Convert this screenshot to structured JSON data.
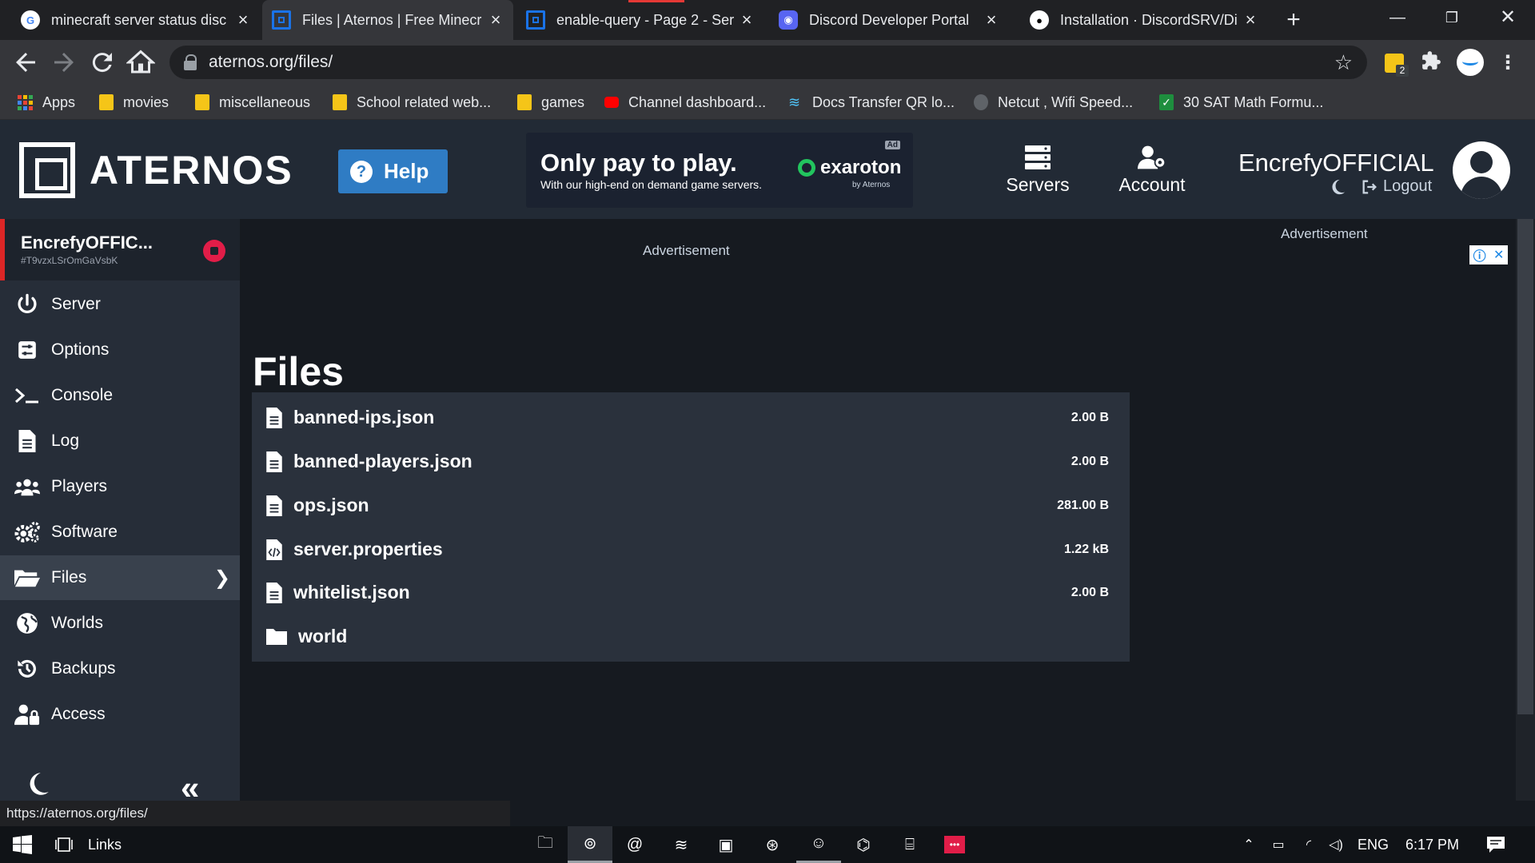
{
  "browser": {
    "tabs": [
      {
        "title": "minecraft server status disc",
        "favicon": "google-icon",
        "active": false
      },
      {
        "title": "Files | Aternos | Free Minecr",
        "favicon": "aternos-icon",
        "active": true
      },
      {
        "title": "enable-query - Page 2 - Ser",
        "favicon": "aternos-icon",
        "active": false
      },
      {
        "title": "Discord Developer Portal",
        "favicon": "discord-icon",
        "active": false
      },
      {
        "title": "Installation · DiscordSRV/Di",
        "favicon": "github-icon",
        "active": false
      }
    ],
    "url": "aternos.org/files/",
    "extension_badge": "2",
    "bookmarks": [
      {
        "label": "Apps",
        "icon": "apps-grid-icon"
      },
      {
        "label": "movies",
        "icon": "folder-icon"
      },
      {
        "label": "miscellaneous",
        "icon": "folder-icon"
      },
      {
        "label": "School related web...",
        "icon": "folder-icon"
      },
      {
        "label": "games",
        "icon": "folder-icon"
      },
      {
        "label": "Channel dashboard...",
        "icon": "youtube-icon"
      },
      {
        "label": "Docs Transfer QR lo...",
        "icon": "wifi-icon"
      },
      {
        "label": "Netcut , Wifi Speed...",
        "icon": "netcut-icon"
      },
      {
        "label": "30 SAT Math Formu...",
        "icon": "check-icon"
      }
    ],
    "status_url": "https://aternos.org/files/"
  },
  "site": {
    "logo_text": "ATERNOS",
    "help_label": "Help",
    "ad": {
      "headline": "Only pay to play.",
      "subline": "With our high-end on demand game servers.",
      "brand": "exaroton",
      "brand_by": "by Aternos",
      "tag": "Ad"
    },
    "nav": [
      {
        "label": "Servers",
        "icon": "servers-icon"
      },
      {
        "label": "Account",
        "icon": "account-gear-icon"
      }
    ],
    "user": {
      "name": "EncrefyOFFICIAL",
      "logout": "Logout"
    }
  },
  "sidebar": {
    "server_name": "EncrefyOFFIC...",
    "server_id": "#T9vzxLSrOmGaVsbK",
    "items": [
      {
        "label": "Server",
        "icon": "power-icon",
        "active": false
      },
      {
        "label": "Options",
        "icon": "sliders-icon",
        "active": false
      },
      {
        "label": "Console",
        "icon": "terminal-icon",
        "active": false
      },
      {
        "label": "Log",
        "icon": "document-icon",
        "active": false
      },
      {
        "label": "Players",
        "icon": "users-icon",
        "active": false
      },
      {
        "label": "Software",
        "icon": "gears-icon",
        "active": false
      },
      {
        "label": "Files",
        "icon": "folder-open-icon",
        "active": true
      },
      {
        "label": "Worlds",
        "icon": "globe-icon",
        "active": false
      },
      {
        "label": "Backups",
        "icon": "history-icon",
        "active": false
      },
      {
        "label": "Access",
        "icon": "user-lock-icon",
        "active": false
      }
    ]
  },
  "main": {
    "ad_label_left": "Advertisement",
    "ad_label_right": "Advertisement",
    "title": "Files",
    "folder_count": "6",
    "files": [
      {
        "name": "banned-ips.json",
        "size": "2.00 B",
        "type": "file"
      },
      {
        "name": "banned-players.json",
        "size": "2.00 B",
        "type": "file"
      },
      {
        "name": "ops.json",
        "size": "281.00 B",
        "type": "file"
      },
      {
        "name": "server.properties",
        "size": "1.22 kB",
        "type": "code"
      },
      {
        "name": "whitelist.json",
        "size": "2.00 B",
        "type": "file"
      },
      {
        "name": "world",
        "size": "",
        "type": "folder"
      }
    ]
  },
  "taskbar": {
    "search_label": "Links",
    "language": "ENG",
    "time": "6:17 PM"
  },
  "colors": {
    "accent_help": "#2f7cc4",
    "stop_red": "#e11d48",
    "exaroton_green": "#22c55e"
  }
}
